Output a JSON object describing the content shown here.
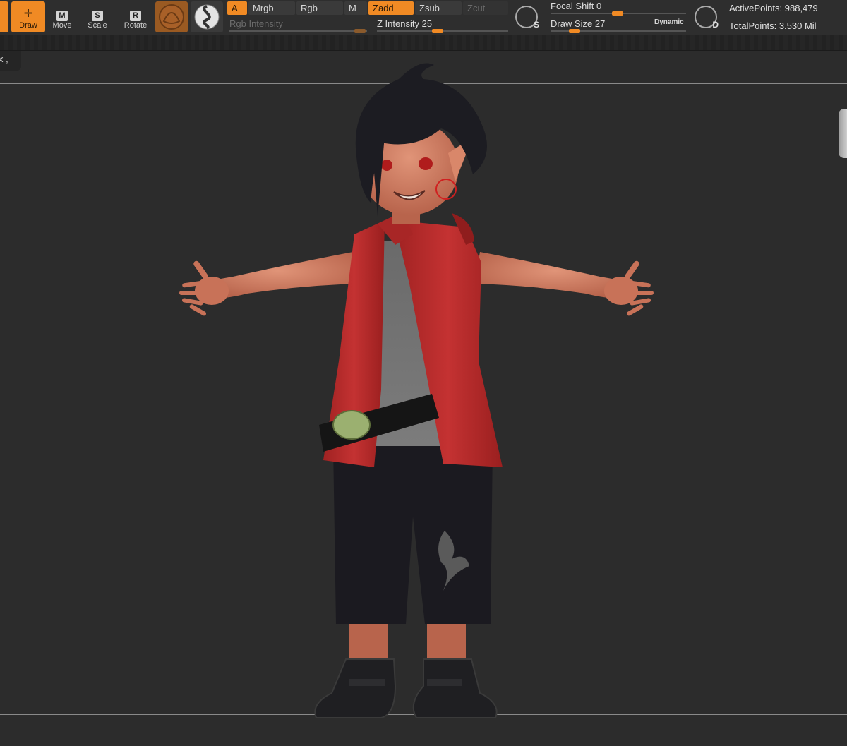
{
  "tools": {
    "draw": {
      "label": "Draw"
    },
    "move": {
      "label": "Move",
      "key": "M"
    },
    "scale": {
      "label": "Scale",
      "key": "S"
    },
    "rotate": {
      "label": "Rotate",
      "key": "R"
    }
  },
  "modes": {
    "a": "A",
    "mrgb": "Mrgb",
    "rgb": "Rgb",
    "m": "M",
    "zadd": "Zadd",
    "zsub": "Zsub",
    "zcut": "Zcut"
  },
  "sliders": {
    "rgb_intensity": {
      "label": "Rgb Intensity"
    },
    "z_intensity": {
      "label": "Z Intensity",
      "value": "25"
    },
    "focal_shift": {
      "label": "Focal Shift",
      "value": "0"
    },
    "draw_size": {
      "label": "Draw Size",
      "value": "27"
    }
  },
  "brush_toggles": {
    "s": "S",
    "d": "D",
    "dynamic": "Dynamic"
  },
  "stats": {
    "active_points": "ActivePoints: 988,479",
    "total_points": "TotalPoints: 3.530 Mil"
  },
  "canvas": {
    "tooltip": "x ,"
  },
  "colors": {
    "accent": "#f08a24",
    "toolbar_bg": "#2e2e2e",
    "canvas_bg": "#2c2c2c",
    "vest": "#b52a2a",
    "skin": "#d9876a",
    "hair": "#1c1c22",
    "shorts": "#1b1a20"
  }
}
